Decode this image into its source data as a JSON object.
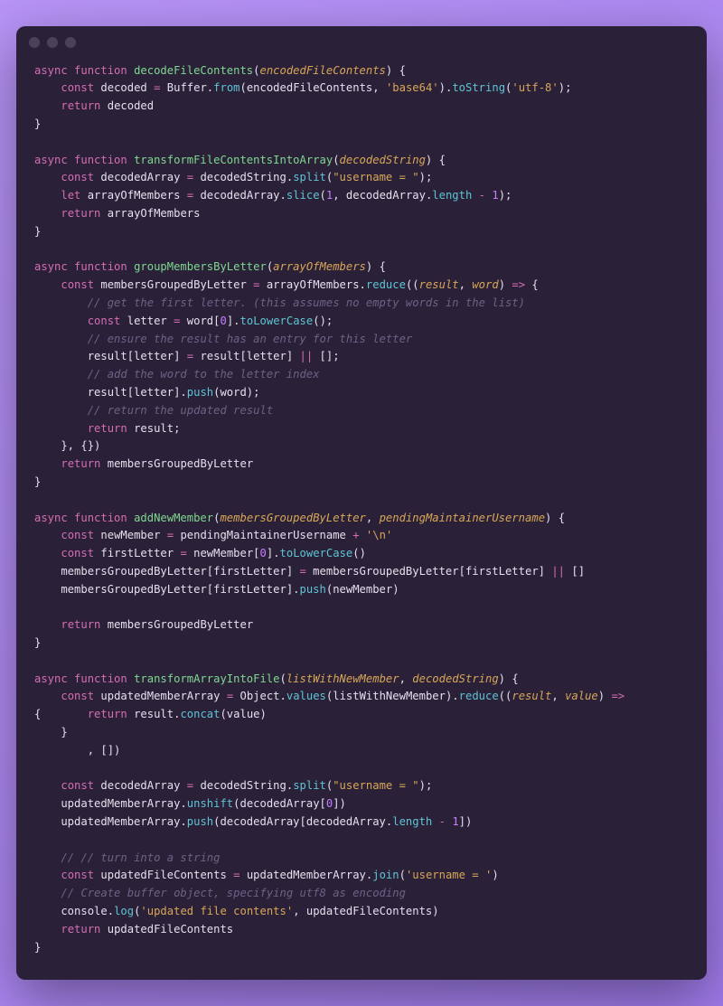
{
  "window": {
    "dots": 3
  },
  "code_lines": [
    [
      {
        "t": "async function ",
        "c": "kw"
      },
      {
        "t": "decodeFileContents",
        "c": "fn"
      },
      {
        "t": "(",
        "c": "punc"
      },
      {
        "t": "encodedFileContents",
        "c": "param"
      },
      {
        "t": ") {",
        "c": "punc"
      }
    ],
    [
      {
        "t": "    ",
        "c": "tok"
      },
      {
        "t": "const ",
        "c": "kw"
      },
      {
        "t": "decoded ",
        "c": "tok"
      },
      {
        "t": "=",
        "c": "op"
      },
      {
        "t": " Buffer.",
        "c": "tok"
      },
      {
        "t": "from",
        "c": "call"
      },
      {
        "t": "(encodedFileContents, ",
        "c": "tok"
      },
      {
        "t": "'base64'",
        "c": "str"
      },
      {
        "t": ").",
        "c": "tok"
      },
      {
        "t": "toString",
        "c": "call"
      },
      {
        "t": "(",
        "c": "tok"
      },
      {
        "t": "'utf-8'",
        "c": "str"
      },
      {
        "t": ");",
        "c": "tok"
      }
    ],
    [
      {
        "t": "    ",
        "c": "tok"
      },
      {
        "t": "return",
        "c": "kw"
      },
      {
        "t": " decoded",
        "c": "tok"
      }
    ],
    [
      {
        "t": "}",
        "c": "punc"
      }
    ],
    [],
    [
      {
        "t": "async function ",
        "c": "kw"
      },
      {
        "t": "transformFileContentsIntoArray",
        "c": "fn"
      },
      {
        "t": "(",
        "c": "punc"
      },
      {
        "t": "decodedString",
        "c": "param"
      },
      {
        "t": ") {",
        "c": "punc"
      }
    ],
    [
      {
        "t": "    ",
        "c": "tok"
      },
      {
        "t": "const ",
        "c": "kw"
      },
      {
        "t": "decodedArray ",
        "c": "tok"
      },
      {
        "t": "=",
        "c": "op"
      },
      {
        "t": " decodedString.",
        "c": "tok"
      },
      {
        "t": "split",
        "c": "call"
      },
      {
        "t": "(",
        "c": "tok"
      },
      {
        "t": "\"username = \"",
        "c": "str"
      },
      {
        "t": ");",
        "c": "tok"
      }
    ],
    [
      {
        "t": "    ",
        "c": "tok"
      },
      {
        "t": "let ",
        "c": "kw"
      },
      {
        "t": "arrayOfMembers ",
        "c": "tok"
      },
      {
        "t": "=",
        "c": "op"
      },
      {
        "t": " decodedArray.",
        "c": "tok"
      },
      {
        "t": "slice",
        "c": "call"
      },
      {
        "t": "(",
        "c": "tok"
      },
      {
        "t": "1",
        "c": "num"
      },
      {
        "t": ", decodedArray.",
        "c": "tok"
      },
      {
        "t": "length",
        "c": "call"
      },
      {
        "t": " ",
        "c": "tok"
      },
      {
        "t": "-",
        "c": "op"
      },
      {
        "t": " ",
        "c": "tok"
      },
      {
        "t": "1",
        "c": "num"
      },
      {
        "t": ");",
        "c": "tok"
      }
    ],
    [
      {
        "t": "    ",
        "c": "tok"
      },
      {
        "t": "return",
        "c": "kw"
      },
      {
        "t": " arrayOfMembers",
        "c": "tok"
      }
    ],
    [
      {
        "t": "}",
        "c": "punc"
      }
    ],
    [],
    [
      {
        "t": "async function ",
        "c": "kw"
      },
      {
        "t": "groupMembersByLetter",
        "c": "fn"
      },
      {
        "t": "(",
        "c": "punc"
      },
      {
        "t": "arrayOfMembers",
        "c": "param"
      },
      {
        "t": ") {",
        "c": "punc"
      }
    ],
    [
      {
        "t": "    ",
        "c": "tok"
      },
      {
        "t": "const ",
        "c": "kw"
      },
      {
        "t": "membersGroupedByLetter ",
        "c": "tok"
      },
      {
        "t": "=",
        "c": "op"
      },
      {
        "t": " arrayOfMembers.",
        "c": "tok"
      },
      {
        "t": "reduce",
        "c": "call"
      },
      {
        "t": "((",
        "c": "tok"
      },
      {
        "t": "result",
        "c": "param"
      },
      {
        "t": ", ",
        "c": "tok"
      },
      {
        "t": "word",
        "c": "param"
      },
      {
        "t": ") ",
        "c": "tok"
      },
      {
        "t": "=>",
        "c": "op"
      },
      {
        "t": " {",
        "c": "tok"
      }
    ],
    [
      {
        "t": "        ",
        "c": "tok"
      },
      {
        "t": "// get the first letter. (this assumes no empty words in the list)",
        "c": "cmt"
      }
    ],
    [
      {
        "t": "        ",
        "c": "tok"
      },
      {
        "t": "const ",
        "c": "kw"
      },
      {
        "t": "letter ",
        "c": "tok"
      },
      {
        "t": "=",
        "c": "op"
      },
      {
        "t": " word[",
        "c": "tok"
      },
      {
        "t": "0",
        "c": "num"
      },
      {
        "t": "].",
        "c": "tok"
      },
      {
        "t": "toLowerCase",
        "c": "call"
      },
      {
        "t": "();",
        "c": "tok"
      }
    ],
    [
      {
        "t": "        ",
        "c": "tok"
      },
      {
        "t": "// ensure the result has an entry for this letter",
        "c": "cmt"
      }
    ],
    [
      {
        "t": "        result[letter] ",
        "c": "tok"
      },
      {
        "t": "=",
        "c": "op"
      },
      {
        "t": " result[letter] ",
        "c": "tok"
      },
      {
        "t": "||",
        "c": "op"
      },
      {
        "t": " [];",
        "c": "tok"
      }
    ],
    [
      {
        "t": "        ",
        "c": "tok"
      },
      {
        "t": "// add the word to the letter index",
        "c": "cmt"
      }
    ],
    [
      {
        "t": "        result[letter].",
        "c": "tok"
      },
      {
        "t": "push",
        "c": "call"
      },
      {
        "t": "(word);",
        "c": "tok"
      }
    ],
    [
      {
        "t": "        ",
        "c": "tok"
      },
      {
        "t": "// return the updated result",
        "c": "cmt"
      }
    ],
    [
      {
        "t": "        ",
        "c": "tok"
      },
      {
        "t": "return",
        "c": "kw"
      },
      {
        "t": " result;",
        "c": "tok"
      }
    ],
    [
      {
        "t": "    }, {})",
        "c": "tok"
      }
    ],
    [
      {
        "t": "    ",
        "c": "tok"
      },
      {
        "t": "return",
        "c": "kw"
      },
      {
        "t": " membersGroupedByLetter",
        "c": "tok"
      }
    ],
    [
      {
        "t": "}",
        "c": "punc"
      }
    ],
    [],
    [
      {
        "t": "async function ",
        "c": "kw"
      },
      {
        "t": "addNewMember",
        "c": "fn"
      },
      {
        "t": "(",
        "c": "punc"
      },
      {
        "t": "membersGroupedByLetter",
        "c": "param"
      },
      {
        "t": ", ",
        "c": "punc"
      },
      {
        "t": "pendingMaintainerUsername",
        "c": "param"
      },
      {
        "t": ") {",
        "c": "punc"
      }
    ],
    [
      {
        "t": "    ",
        "c": "tok"
      },
      {
        "t": "const ",
        "c": "kw"
      },
      {
        "t": "newMember ",
        "c": "tok"
      },
      {
        "t": "=",
        "c": "op"
      },
      {
        "t": " pendingMaintainerUsername ",
        "c": "tok"
      },
      {
        "t": "+",
        "c": "op"
      },
      {
        "t": " ",
        "c": "tok"
      },
      {
        "t": "'\\n'",
        "c": "str"
      }
    ],
    [
      {
        "t": "    ",
        "c": "tok"
      },
      {
        "t": "const ",
        "c": "kw"
      },
      {
        "t": "firstLetter ",
        "c": "tok"
      },
      {
        "t": "=",
        "c": "op"
      },
      {
        "t": " newMember[",
        "c": "tok"
      },
      {
        "t": "0",
        "c": "num"
      },
      {
        "t": "].",
        "c": "tok"
      },
      {
        "t": "toLowerCase",
        "c": "call"
      },
      {
        "t": "()",
        "c": "tok"
      }
    ],
    [
      {
        "t": "    membersGroupedByLetter[firstLetter] ",
        "c": "tok"
      },
      {
        "t": "=",
        "c": "op"
      },
      {
        "t": " membersGroupedByLetter[firstLetter] ",
        "c": "tok"
      },
      {
        "t": "||",
        "c": "op"
      },
      {
        "t": " []",
        "c": "tok"
      }
    ],
    [
      {
        "t": "    membersGroupedByLetter[firstLetter].",
        "c": "tok"
      },
      {
        "t": "push",
        "c": "call"
      },
      {
        "t": "(newMember)",
        "c": "tok"
      }
    ],
    [],
    [
      {
        "t": "    ",
        "c": "tok"
      },
      {
        "t": "return",
        "c": "kw"
      },
      {
        "t": " membersGroupedByLetter",
        "c": "tok"
      }
    ],
    [
      {
        "t": "}",
        "c": "punc"
      }
    ],
    [],
    [
      {
        "t": "async function ",
        "c": "kw"
      },
      {
        "t": "transformArrayIntoFile",
        "c": "fn"
      },
      {
        "t": "(",
        "c": "punc"
      },
      {
        "t": "listWithNewMember",
        "c": "param"
      },
      {
        "t": ", ",
        "c": "punc"
      },
      {
        "t": "decodedString",
        "c": "param"
      },
      {
        "t": ") {",
        "c": "punc"
      }
    ],
    [
      {
        "t": "    ",
        "c": "tok"
      },
      {
        "t": "const ",
        "c": "kw"
      },
      {
        "t": "updatedMemberArray ",
        "c": "tok"
      },
      {
        "t": "=",
        "c": "op"
      },
      {
        "t": " Object.",
        "c": "tok"
      },
      {
        "t": "values",
        "c": "call"
      },
      {
        "t": "(listWithNewMember).",
        "c": "tok"
      },
      {
        "t": "reduce",
        "c": "call"
      },
      {
        "t": "((",
        "c": "tok"
      },
      {
        "t": "result",
        "c": "param"
      },
      {
        "t": ", ",
        "c": "tok"
      },
      {
        "t": "value",
        "c": "param"
      },
      {
        "t": ") ",
        "c": "tok"
      },
      {
        "t": "=>",
        "c": "op"
      }
    ],
    [
      {
        "t": "{       ",
        "c": "tok"
      },
      {
        "t": "return",
        "c": "kw"
      },
      {
        "t": " result.",
        "c": "tok"
      },
      {
        "t": "concat",
        "c": "call"
      },
      {
        "t": "(value)",
        "c": "tok"
      }
    ],
    [
      {
        "t": "    }",
        "c": "tok"
      }
    ],
    [
      {
        "t": "        , [])",
        "c": "tok"
      }
    ],
    [],
    [
      {
        "t": "    ",
        "c": "tok"
      },
      {
        "t": "const ",
        "c": "kw"
      },
      {
        "t": "decodedArray ",
        "c": "tok"
      },
      {
        "t": "=",
        "c": "op"
      },
      {
        "t": " decodedString.",
        "c": "tok"
      },
      {
        "t": "split",
        "c": "call"
      },
      {
        "t": "(",
        "c": "tok"
      },
      {
        "t": "\"username = \"",
        "c": "str"
      },
      {
        "t": ");",
        "c": "tok"
      }
    ],
    [
      {
        "t": "    updatedMemberArray.",
        "c": "tok"
      },
      {
        "t": "unshift",
        "c": "call"
      },
      {
        "t": "(decodedArray[",
        "c": "tok"
      },
      {
        "t": "0",
        "c": "num"
      },
      {
        "t": "])",
        "c": "tok"
      }
    ],
    [
      {
        "t": "    updatedMemberArray.",
        "c": "tok"
      },
      {
        "t": "push",
        "c": "call"
      },
      {
        "t": "(decodedArray[decodedArray.",
        "c": "tok"
      },
      {
        "t": "length",
        "c": "call"
      },
      {
        "t": " ",
        "c": "tok"
      },
      {
        "t": "-",
        "c": "op"
      },
      {
        "t": " ",
        "c": "tok"
      },
      {
        "t": "1",
        "c": "num"
      },
      {
        "t": "])",
        "c": "tok"
      }
    ],
    [],
    [
      {
        "t": "    ",
        "c": "tok"
      },
      {
        "t": "// // turn into a string",
        "c": "cmt"
      }
    ],
    [
      {
        "t": "    ",
        "c": "tok"
      },
      {
        "t": "const ",
        "c": "kw"
      },
      {
        "t": "updatedFileContents ",
        "c": "tok"
      },
      {
        "t": "=",
        "c": "op"
      },
      {
        "t": " updatedMemberArray.",
        "c": "tok"
      },
      {
        "t": "join",
        "c": "call"
      },
      {
        "t": "(",
        "c": "tok"
      },
      {
        "t": "'username = '",
        "c": "str"
      },
      {
        "t": ")",
        "c": "tok"
      }
    ],
    [
      {
        "t": "    ",
        "c": "tok"
      },
      {
        "t": "// Create buffer object, specifying utf8 as encoding",
        "c": "cmt"
      }
    ],
    [
      {
        "t": "    console.",
        "c": "tok"
      },
      {
        "t": "log",
        "c": "call"
      },
      {
        "t": "(",
        "c": "tok"
      },
      {
        "t": "'updated file contents'",
        "c": "str"
      },
      {
        "t": ", updatedFileContents)",
        "c": "tok"
      }
    ],
    [
      {
        "t": "    ",
        "c": "tok"
      },
      {
        "t": "return",
        "c": "kw"
      },
      {
        "t": " updatedFileContents",
        "c": "tok"
      }
    ],
    [
      {
        "t": "}",
        "c": "punc"
      }
    ]
  ]
}
